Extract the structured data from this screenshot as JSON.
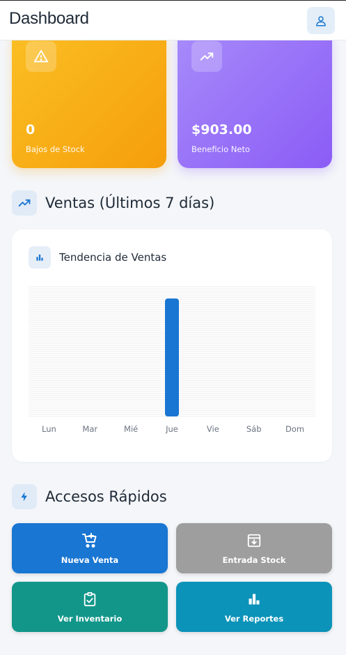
{
  "header": {
    "title": "Dashboard",
    "user_icon": "user-icon"
  },
  "cards": [
    {
      "value": "0",
      "label": "Bajos de Stock",
      "icon": "warning-icon",
      "color": "#f59e0b"
    },
    {
      "value": "$903.00",
      "label": "Beneficio Neto",
      "icon": "trending-up-icon",
      "color": "#8b5cf6"
    }
  ],
  "sales_section": {
    "title": "Ventas (Últimos 7 días)",
    "icon": "trending-up-icon"
  },
  "chart_card": {
    "title": "Tendencia de Ventas",
    "icon": "bar-chart-icon"
  },
  "chart_data": {
    "type": "bar",
    "categories": [
      "Lun",
      "Mar",
      "Mié",
      "Jue",
      "Vie",
      "Sáb",
      "Dom"
    ],
    "values": [
      0,
      0,
      0,
      1,
      0,
      0,
      0
    ],
    "ylim": [
      0,
      1.1
    ],
    "grid": true,
    "bar_color": "#1976d2"
  },
  "quick_section": {
    "title": "Accesos Rápidos",
    "icon": "bolt-icon"
  },
  "quick_actions": [
    {
      "label": "Nueva Venta",
      "icon": "add-cart-icon",
      "color": "#1976d2"
    },
    {
      "label": "Entrada Stock",
      "icon": "archive-in-icon",
      "color": "#9e9e9e"
    },
    {
      "label": "Ver Inventario",
      "icon": "clipboard-check-icon",
      "color": "#12968a"
    },
    {
      "label": "Ver Reportes",
      "icon": "bar-chart-icon",
      "color": "#0b93b9"
    }
  ]
}
